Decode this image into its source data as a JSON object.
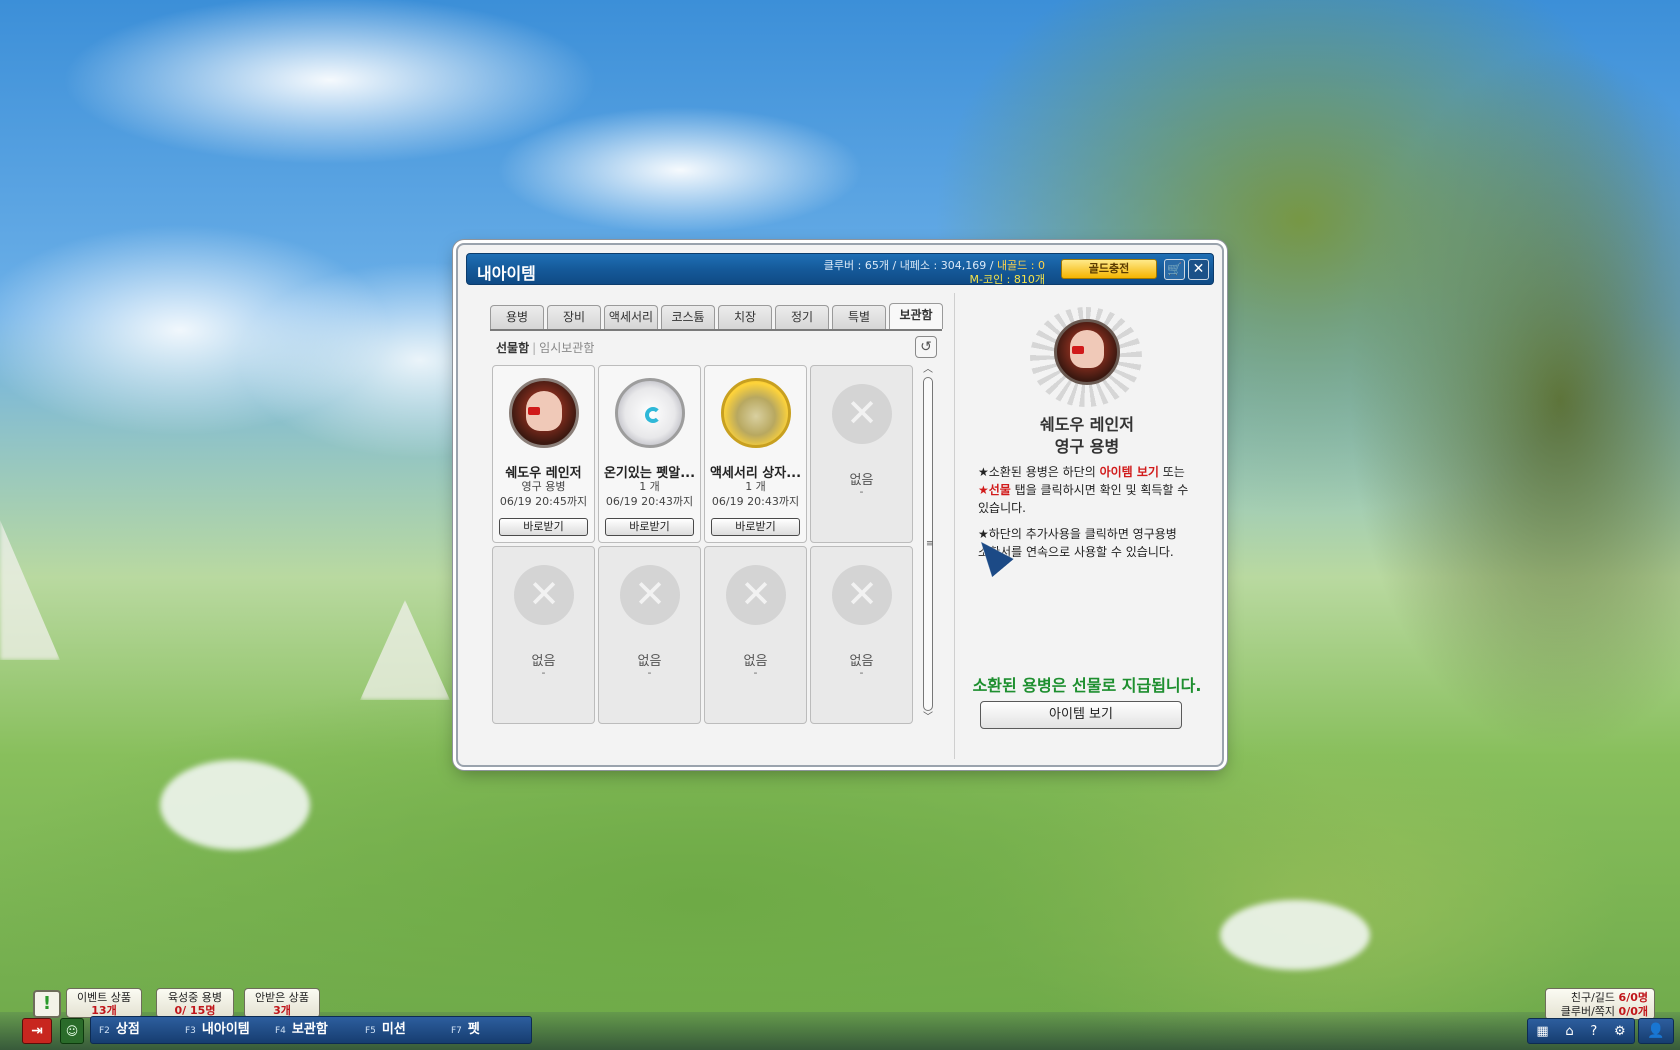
{
  "window": {
    "title": "내아이템",
    "currency": {
      "cluber": "클루버 : 65개",
      "sep1": " / ",
      "naepeso": "내페소 : 304,169",
      "sep2": " / ",
      "gold": "내골드 : 0",
      "mcoin": "M-코인 : 810개"
    },
    "charge_button": "골드충전",
    "cart_icon": "cart-icon",
    "close_icon": "close-icon"
  },
  "tabs": [
    "용병",
    "장비",
    "액세서리",
    "코스튬",
    "치장",
    "정기",
    "특별",
    "보관함"
  ],
  "active_tab": "보관함",
  "subtabs": {
    "active": "선물함",
    "separator": "|",
    "inactive": "임시보관함"
  },
  "refresh_glyph": "↺",
  "slots": [
    {
      "name": "쉐도우 레인저",
      "sub": "영구 용병",
      "date": "06/19 20:45까지",
      "button": "바로받기",
      "icon": "mercenary-portrait-icon"
    },
    {
      "name": "온기있는 펫알...",
      "sub": "1 개",
      "date": "06/19 20:43까지",
      "button": "바로받기",
      "icon": "pet-egg-icon"
    },
    {
      "name": "액세서리 상자...",
      "sub": "1 개",
      "date": "06/19 20:43까지",
      "button": "바로받기",
      "icon": "accessory-box-icon"
    }
  ],
  "empty_slot": {
    "label": "없음",
    "dash": "-",
    "mark": "✕"
  },
  "scroll": {
    "up": "︿",
    "down": "﹀",
    "grip": "≡"
  },
  "detail": {
    "name": "쉐도우 레인저",
    "type": "영구 용병",
    "para1": {
      "prefix": "★소환된 용병은 하단의 ",
      "red1": "아이템 보기",
      "middle": " 또는 ",
      "red2": "★선물",
      "suffix": " 탭을 클릭하시면 확인 및 획득할 수 있습니다."
    },
    "para2": "★하단의 추가사용을 클릭하면 영구용병 소환서를 연속으로 사용할 수 있습니다.",
    "notice": "소환된 용병은 선물로 지급됩니다.",
    "view_button": "아이템 보기"
  },
  "hud": {
    "alert_glyph": "!",
    "pills": [
      {
        "label": "이벤트 상품",
        "count": "13개"
      },
      {
        "label": "육성중 용병",
        "count": "0/ 15명"
      },
      {
        "label": "안받은 상품",
        "count": "3개"
      }
    ],
    "exit_glyph": "⇥",
    "chat_glyph": "☺",
    "menu": [
      {
        "key": "F2",
        "label": "상점"
      },
      {
        "key": "F3",
        "label": "내아이템"
      },
      {
        "key": "F4",
        "label": "보관함"
      },
      {
        "key": "F5",
        "label": "미션"
      },
      {
        "key": "F7",
        "label": "펫"
      }
    ],
    "friend_label": "친구/길드 ",
    "friend_count": "6/0명",
    "mail_label": "클루버/쪽지 ",
    "mail_count": "0/0개",
    "sys_glyphs": [
      "▦",
      "⌂",
      "?",
      "⚙"
    ],
    "user_glyph": "👤"
  }
}
